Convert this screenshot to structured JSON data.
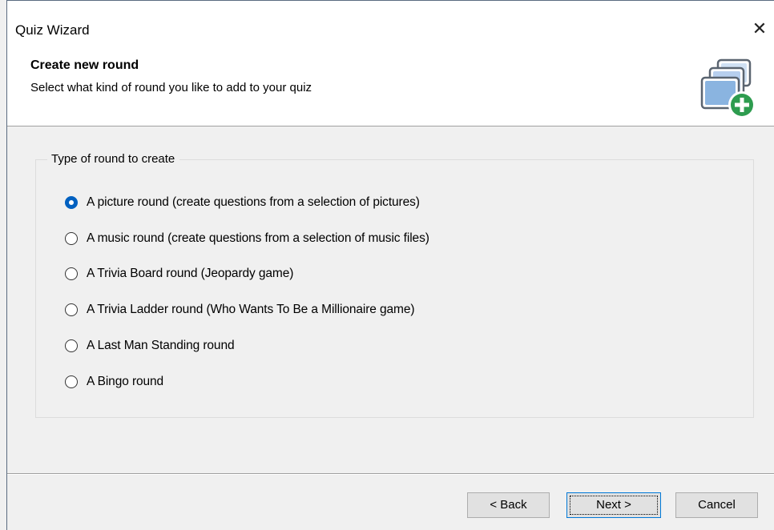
{
  "window": {
    "title": "Quiz Wizard",
    "close_glyph": "✕"
  },
  "header": {
    "title": "Create new round",
    "subtitle": "Select what kind of round you like to add to your quiz",
    "icon": "add-round-icon"
  },
  "group": {
    "legend": "Type of round to create",
    "options": [
      {
        "label": "A picture round (create questions from a selection of pictures)",
        "checked": true
      },
      {
        "label": "A music round (create questions from a selection of music files)",
        "checked": false
      },
      {
        "label": "A Trivia Board round (Jeopardy game)",
        "checked": false
      },
      {
        "label": "A Trivia Ladder round (Who Wants To Be a Millionaire game)",
        "checked": false
      },
      {
        "label": "A Last Man Standing round",
        "checked": false
      },
      {
        "label": "A Bingo round",
        "checked": false
      }
    ]
  },
  "buttons": {
    "back": "< Back",
    "next": "Next >",
    "cancel": "Cancel"
  },
  "colors": {
    "accent": "#0060c0",
    "icon_green": "#2e9c4f",
    "icon_blue": "#8ab4e0"
  }
}
